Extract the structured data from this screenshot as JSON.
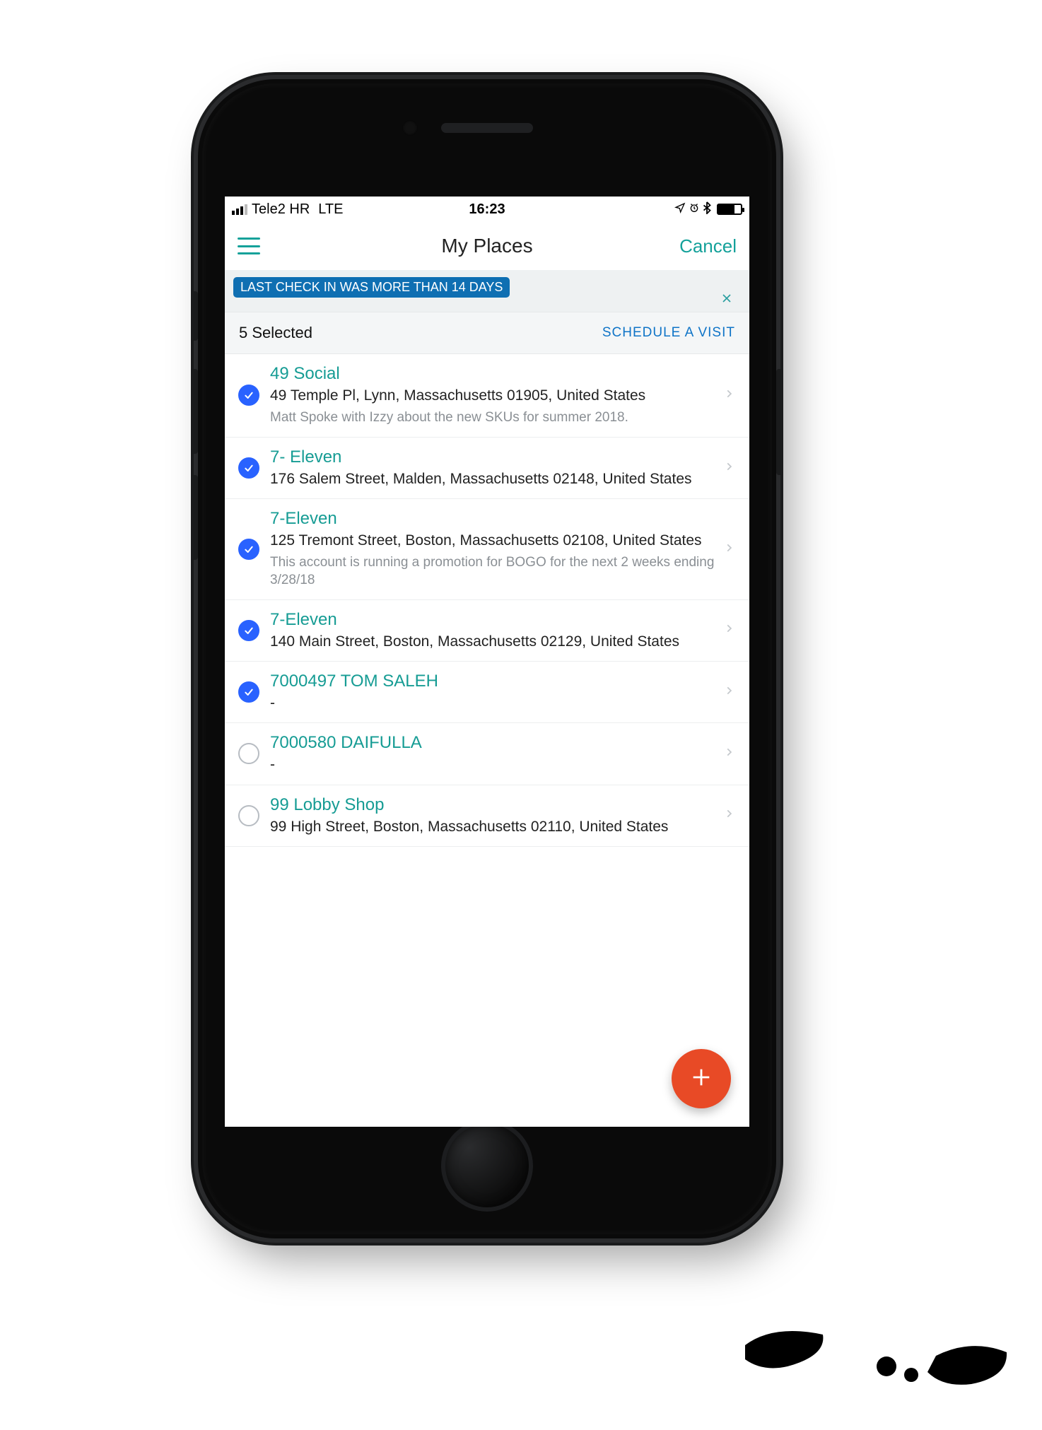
{
  "status_bar": {
    "carrier": "Tele2 HR",
    "network": "LTE",
    "time": "16:23"
  },
  "nav": {
    "title": "My Places",
    "cancel_label": "Cancel"
  },
  "filter": {
    "chip_text": "LAST CHECK IN WAS MORE THAN 14 DAYS"
  },
  "selection": {
    "count_label": "5 Selected",
    "schedule_label": "SCHEDULE A VISIT"
  },
  "places": [
    {
      "selected": true,
      "name": "49 Social",
      "address": "49 Temple Pl, Lynn, Massachusetts 01905, United States",
      "note": "Matt Spoke with Izzy about the new SKUs for summer 2018."
    },
    {
      "selected": true,
      "name": "7- Eleven",
      "address": "176 Salem Street, Malden, Massachusetts 02148, United States",
      "note": ""
    },
    {
      "selected": true,
      "name": "7-Eleven",
      "address": "125 Tremont Street, Boston, Massachusetts 02108, United States",
      "note": "This account is running a promotion for BOGO for the next 2 weeks ending 3/28/18"
    },
    {
      "selected": true,
      "name": "7-Eleven",
      "address": "140 Main Street, Boston, Massachusetts 02129, United States",
      "note": ""
    },
    {
      "selected": true,
      "name": "7000497 TOM SALEH",
      "address": "-",
      "note": ""
    },
    {
      "selected": false,
      "name": "7000580 DAIFULLA",
      "address": "-",
      "note": ""
    },
    {
      "selected": false,
      "name": "99 Lobby Shop",
      "address": "99 High Street, Boston, Massachusetts 02110, United States",
      "note": ""
    }
  ]
}
